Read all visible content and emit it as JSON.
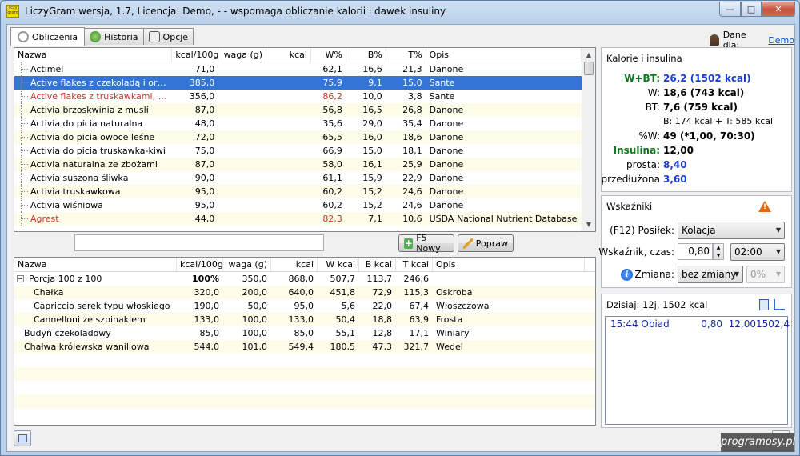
{
  "window": {
    "title": "LiczyGram wersja, 1.7, Licencja: Demo, - - wspomaga obliczanie kalorii i dawek insuliny",
    "min_label": "—",
    "max_label": "□",
    "close_label": "✕",
    "app_icon_text": "liczy gram"
  },
  "tabs": [
    {
      "label": "Obliczenia",
      "active": true
    },
    {
      "label": "Historia",
      "active": false
    },
    {
      "label": "Opcje",
      "active": false
    }
  ],
  "user": {
    "label": "Dane dla:",
    "name": "Demo"
  },
  "products": {
    "columns": [
      "Nazwa",
      "kcal/100g",
      "waga (g)",
      "kcal",
      "W%",
      "B%",
      "T%",
      "Opis"
    ],
    "rows": [
      {
        "name": "Actimel",
        "kcal100": "71,0",
        "waga": "",
        "kcal": "",
        "w": "62,1",
        "b": "16,6",
        "t": "21,3",
        "opis": "Danone",
        "style": ""
      },
      {
        "name": "Active flakes z czekoladą i orzech...",
        "kcal100": "385,0",
        "waga": "",
        "kcal": "",
        "w": "75,9",
        "b": "9,1",
        "t": "15,0",
        "opis": "Sante",
        "style": "sel"
      },
      {
        "name": "Active flakes z truskawkami, malin...",
        "kcal100": "356,0",
        "waga": "",
        "kcal": "",
        "w": "86,2",
        "b": "10,0",
        "t": "3,8",
        "opis": "Sante",
        "style": "red"
      },
      {
        "name": "Activia brzoskwinia z musli",
        "kcal100": "87,0",
        "waga": "",
        "kcal": "",
        "w": "56,8",
        "b": "16,5",
        "t": "26,8",
        "opis": "Danone",
        "style": ""
      },
      {
        "name": "Activia do picia naturalna",
        "kcal100": "48,0",
        "waga": "",
        "kcal": "",
        "w": "35,6",
        "b": "29,0",
        "t": "35,4",
        "opis": "Danone",
        "style": ""
      },
      {
        "name": "Activia do picia owoce leśne",
        "kcal100": "72,0",
        "waga": "",
        "kcal": "",
        "w": "65,5",
        "b": "16,0",
        "t": "18,6",
        "opis": "Danone",
        "style": ""
      },
      {
        "name": "Activia do picia truskawka-kiwi",
        "kcal100": "75,0",
        "waga": "",
        "kcal": "",
        "w": "66,9",
        "b": "15,0",
        "t": "18,1",
        "opis": "Danone",
        "style": ""
      },
      {
        "name": "Activia naturalna ze zbożami",
        "kcal100": "87,0",
        "waga": "",
        "kcal": "",
        "w": "58,0",
        "b": "16,1",
        "t": "25,9",
        "opis": "Danone",
        "style": ""
      },
      {
        "name": "Activia suszona śliwka",
        "kcal100": "90,0",
        "waga": "",
        "kcal": "",
        "w": "61,1",
        "b": "15,9",
        "t": "22,9",
        "opis": "Danone",
        "style": ""
      },
      {
        "name": "Activia truskawkowa",
        "kcal100": "95,0",
        "waga": "",
        "kcal": "",
        "w": "60,2",
        "b": "15,2",
        "t": "24,6",
        "opis": "Danone",
        "style": ""
      },
      {
        "name": "Activia wiśniowa",
        "kcal100": "95,0",
        "waga": "",
        "kcal": "",
        "w": "60,2",
        "b": "15,2",
        "t": "24,6",
        "opis": "Danone",
        "style": ""
      },
      {
        "name": "Agrest",
        "kcal100": "44,0",
        "waga": "",
        "kcal": "",
        "w": "82,3",
        "b": "7,1",
        "t": "10,6",
        "opis": "USDA National Nutrient Database",
        "style": "red"
      }
    ]
  },
  "search": {
    "value": ""
  },
  "buttons": {
    "new_label": "F5 Nowy",
    "edit_label": "Popraw"
  },
  "meal": {
    "columns": [
      "Nazwa",
      "kcal/100g",
      "waga (g)",
      "kcal",
      "W kcal",
      "B kcal",
      "T kcal",
      "Opis"
    ],
    "rows": [
      {
        "name": "Porcja 100 z 100",
        "kcal100": "100%",
        "waga": "350,0",
        "kcal": "868,0",
        "w": "507,7",
        "b": "113,7",
        "t": "246,6",
        "opis": "",
        "level": 0,
        "bold100": true
      },
      {
        "name": "Chałka",
        "kcal100": "320,0",
        "waga": "200,0",
        "kcal": "640,0",
        "w": "451,8",
        "b": "72,9",
        "t": "115,3",
        "opis": "Oskroba",
        "level": 1
      },
      {
        "name": "Capriccio serek typu włoskiego",
        "kcal100": "190,0",
        "waga": "50,0",
        "kcal": "95,0",
        "w": "5,6",
        "b": "22,0",
        "t": "67,4",
        "opis": "Włoszczowa",
        "level": 1
      },
      {
        "name": "Cannelloni ze szpinakiem",
        "kcal100": "133,0",
        "waga": "100,0",
        "kcal": "133,0",
        "w": "50,4",
        "b": "18,8",
        "t": "63,9",
        "opis": "Frosta",
        "level": 1
      },
      {
        "name": "Budyń czekoladowy",
        "kcal100": "85,0",
        "waga": "100,0",
        "kcal": "85,0",
        "w": "55,1",
        "b": "12,8",
        "t": "17,1",
        "opis": "Winiary",
        "level": 0
      },
      {
        "name": "Chałwa królewska waniliowa",
        "kcal100": "544,0",
        "waga": "101,0",
        "kcal": "549,4",
        "w": "180,5",
        "b": "47,3",
        "t": "321,7",
        "opis": "Wedel",
        "level": 0
      }
    ]
  },
  "calories": {
    "title": "Kalorie i insulina",
    "wbt_label": "W+BT:",
    "wbt_value": "26,2 (1502 kcal)",
    "w_label": "W:",
    "w_value": "18,6 (743 kcal)",
    "bt_label": "BT:",
    "bt_value": "7,6 (759 kcal)",
    "bt_detail": "B: 174 kcal + T: 585 kcal",
    "pw_label": "%W:",
    "pw_value": "49 (*1,00, 70:30)",
    "ins_label": "Insulina:",
    "ins_value": "12,00",
    "prosta_label": "prosta:",
    "prosta_value": "8,40",
    "przed_label": "przedłużona",
    "przed_value": "3,60"
  },
  "indicators": {
    "title": "Wskaźniki",
    "meal_label": "(F12) Posiłek:",
    "meal_value": "Kolacja",
    "ratio_label": "Wskaźnik, czas:",
    "ratio_value": "0,80",
    "time_value": "02:00",
    "change_label": "Zmiana:",
    "change_value": "bez zmiany",
    "change_pct": "0%"
  },
  "today": {
    "title": "Dzisiaj: 12j, 1502 kcal",
    "entries": [
      {
        "time": "15:44 Obiad",
        "ratio": "0,80",
        "units": "12,00",
        "kcal": "1502,4"
      }
    ]
  },
  "watermark": "programosy.pl",
  "colors": {
    "selection": "#3375d6",
    "alt_row": "#fcfce8",
    "value_blue": "#1a3fd1",
    "label_green": "#0b7a1c",
    "warning": "#e06b12"
  }
}
